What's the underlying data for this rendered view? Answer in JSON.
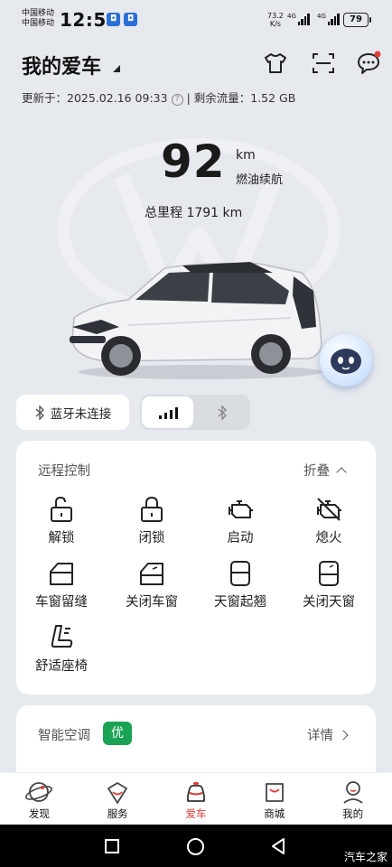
{
  "status_bar": {
    "carrier1": "中国移动",
    "carrier2": "中国移动",
    "time": "12:51",
    "net_speed": "73.2",
    "net_speed_unit": "K/s",
    "signal1": "4G",
    "signal2": "4G",
    "battery": "79"
  },
  "header": {
    "title": "我的爱车",
    "update_label": "更新于：",
    "update_time": "2025.02.16 09:33",
    "data_label": "| 剩余流量：",
    "data_remaining": "1.52 GB"
  },
  "vehicle": {
    "range_value": "92",
    "range_unit": "km",
    "range_label": "燃油续航",
    "odometer_label": "总里程",
    "odometer_value": "1791 km"
  },
  "connection": {
    "bluetooth_status": "蓝牙未连接"
  },
  "remote_control": {
    "title": "远程控制",
    "fold_label": "折叠",
    "items": [
      {
        "label": "解锁",
        "icon": "unlock-icon"
      },
      {
        "label": "闭锁",
        "icon": "lock-icon"
      },
      {
        "label": "启动",
        "icon": "engine-start-icon"
      },
      {
        "label": "熄火",
        "icon": "engine-off-icon"
      },
      {
        "label": "车窗留缝",
        "icon": "window-vent-icon"
      },
      {
        "label": "关闭车窗",
        "icon": "window-close-icon"
      },
      {
        "label": "天窗起翘",
        "icon": "sunroof-tilt-icon"
      },
      {
        "label": "关闭天窗",
        "icon": "sunroof-close-icon"
      },
      {
        "label": "舒适座椅",
        "icon": "seat-icon"
      }
    ]
  },
  "climate": {
    "title": "智能空调",
    "badge": "优",
    "details_label": "详情"
  },
  "tabs": [
    {
      "label": "发现",
      "icon": "planet-icon"
    },
    {
      "label": "服务",
      "icon": "service-icon"
    },
    {
      "label": "爱车",
      "icon": "car-icon"
    },
    {
      "label": "商城",
      "icon": "shopping-bag-icon"
    },
    {
      "label": "我的",
      "icon": "profile-icon"
    }
  ],
  "watermark": "汽车之家",
  "colors": {
    "accent_red": "#e03d3d",
    "badge_green": "#1aa354"
  }
}
